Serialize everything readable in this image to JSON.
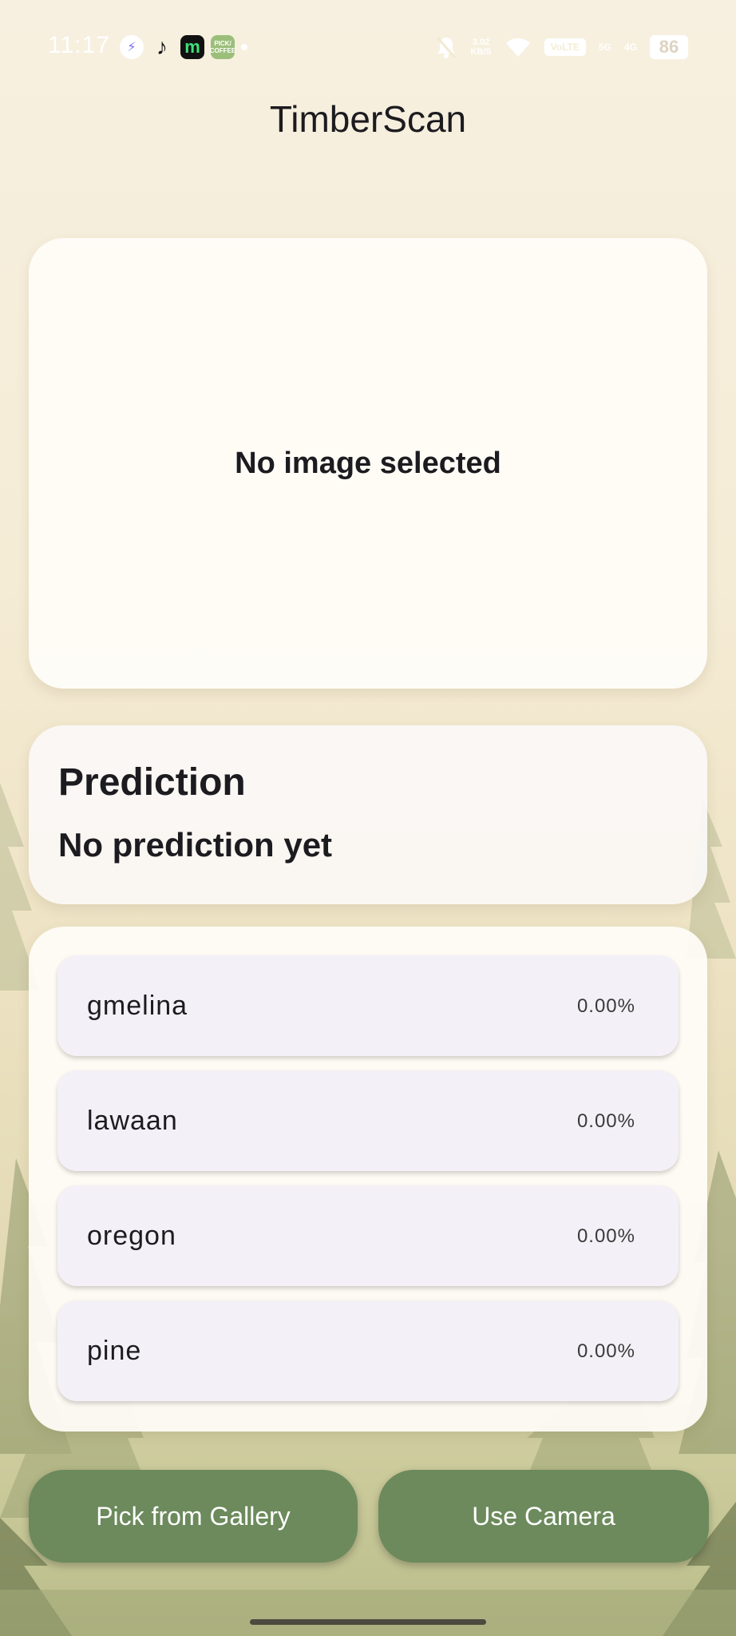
{
  "status_bar": {
    "time": "11:17",
    "net_speed_value": "3.02",
    "net_speed_unit": "KB/S",
    "volte": "VoLTE",
    "signal_5g": "5G",
    "signal_4g": "4G",
    "battery": "86",
    "left_icons": [
      "messenger-icon",
      "tiktok-icon",
      "m-app-icon",
      "pick-coffee-icon"
    ],
    "pick_coffee_label": "PICK/ COFFEE"
  },
  "app_bar": {
    "title": "TimberScan"
  },
  "image_panel": {
    "placeholder": "No image selected"
  },
  "prediction": {
    "heading": "Prediction",
    "result": "No prediction yet"
  },
  "classes": [
    {
      "name": "gmelina",
      "score": "0.00%"
    },
    {
      "name": "lawaan",
      "score": "0.00%"
    },
    {
      "name": "oregon",
      "score": "0.00%"
    },
    {
      "name": "pine",
      "score": "0.00%"
    }
  ],
  "actions": {
    "gallery_label": "Pick from Gallery",
    "camera_label": "Use Camera"
  },
  "colors": {
    "button": "#6c8a5c",
    "card": "#fffdf9",
    "list_item": "#f4f0f7",
    "background": "#f5ecd6"
  }
}
